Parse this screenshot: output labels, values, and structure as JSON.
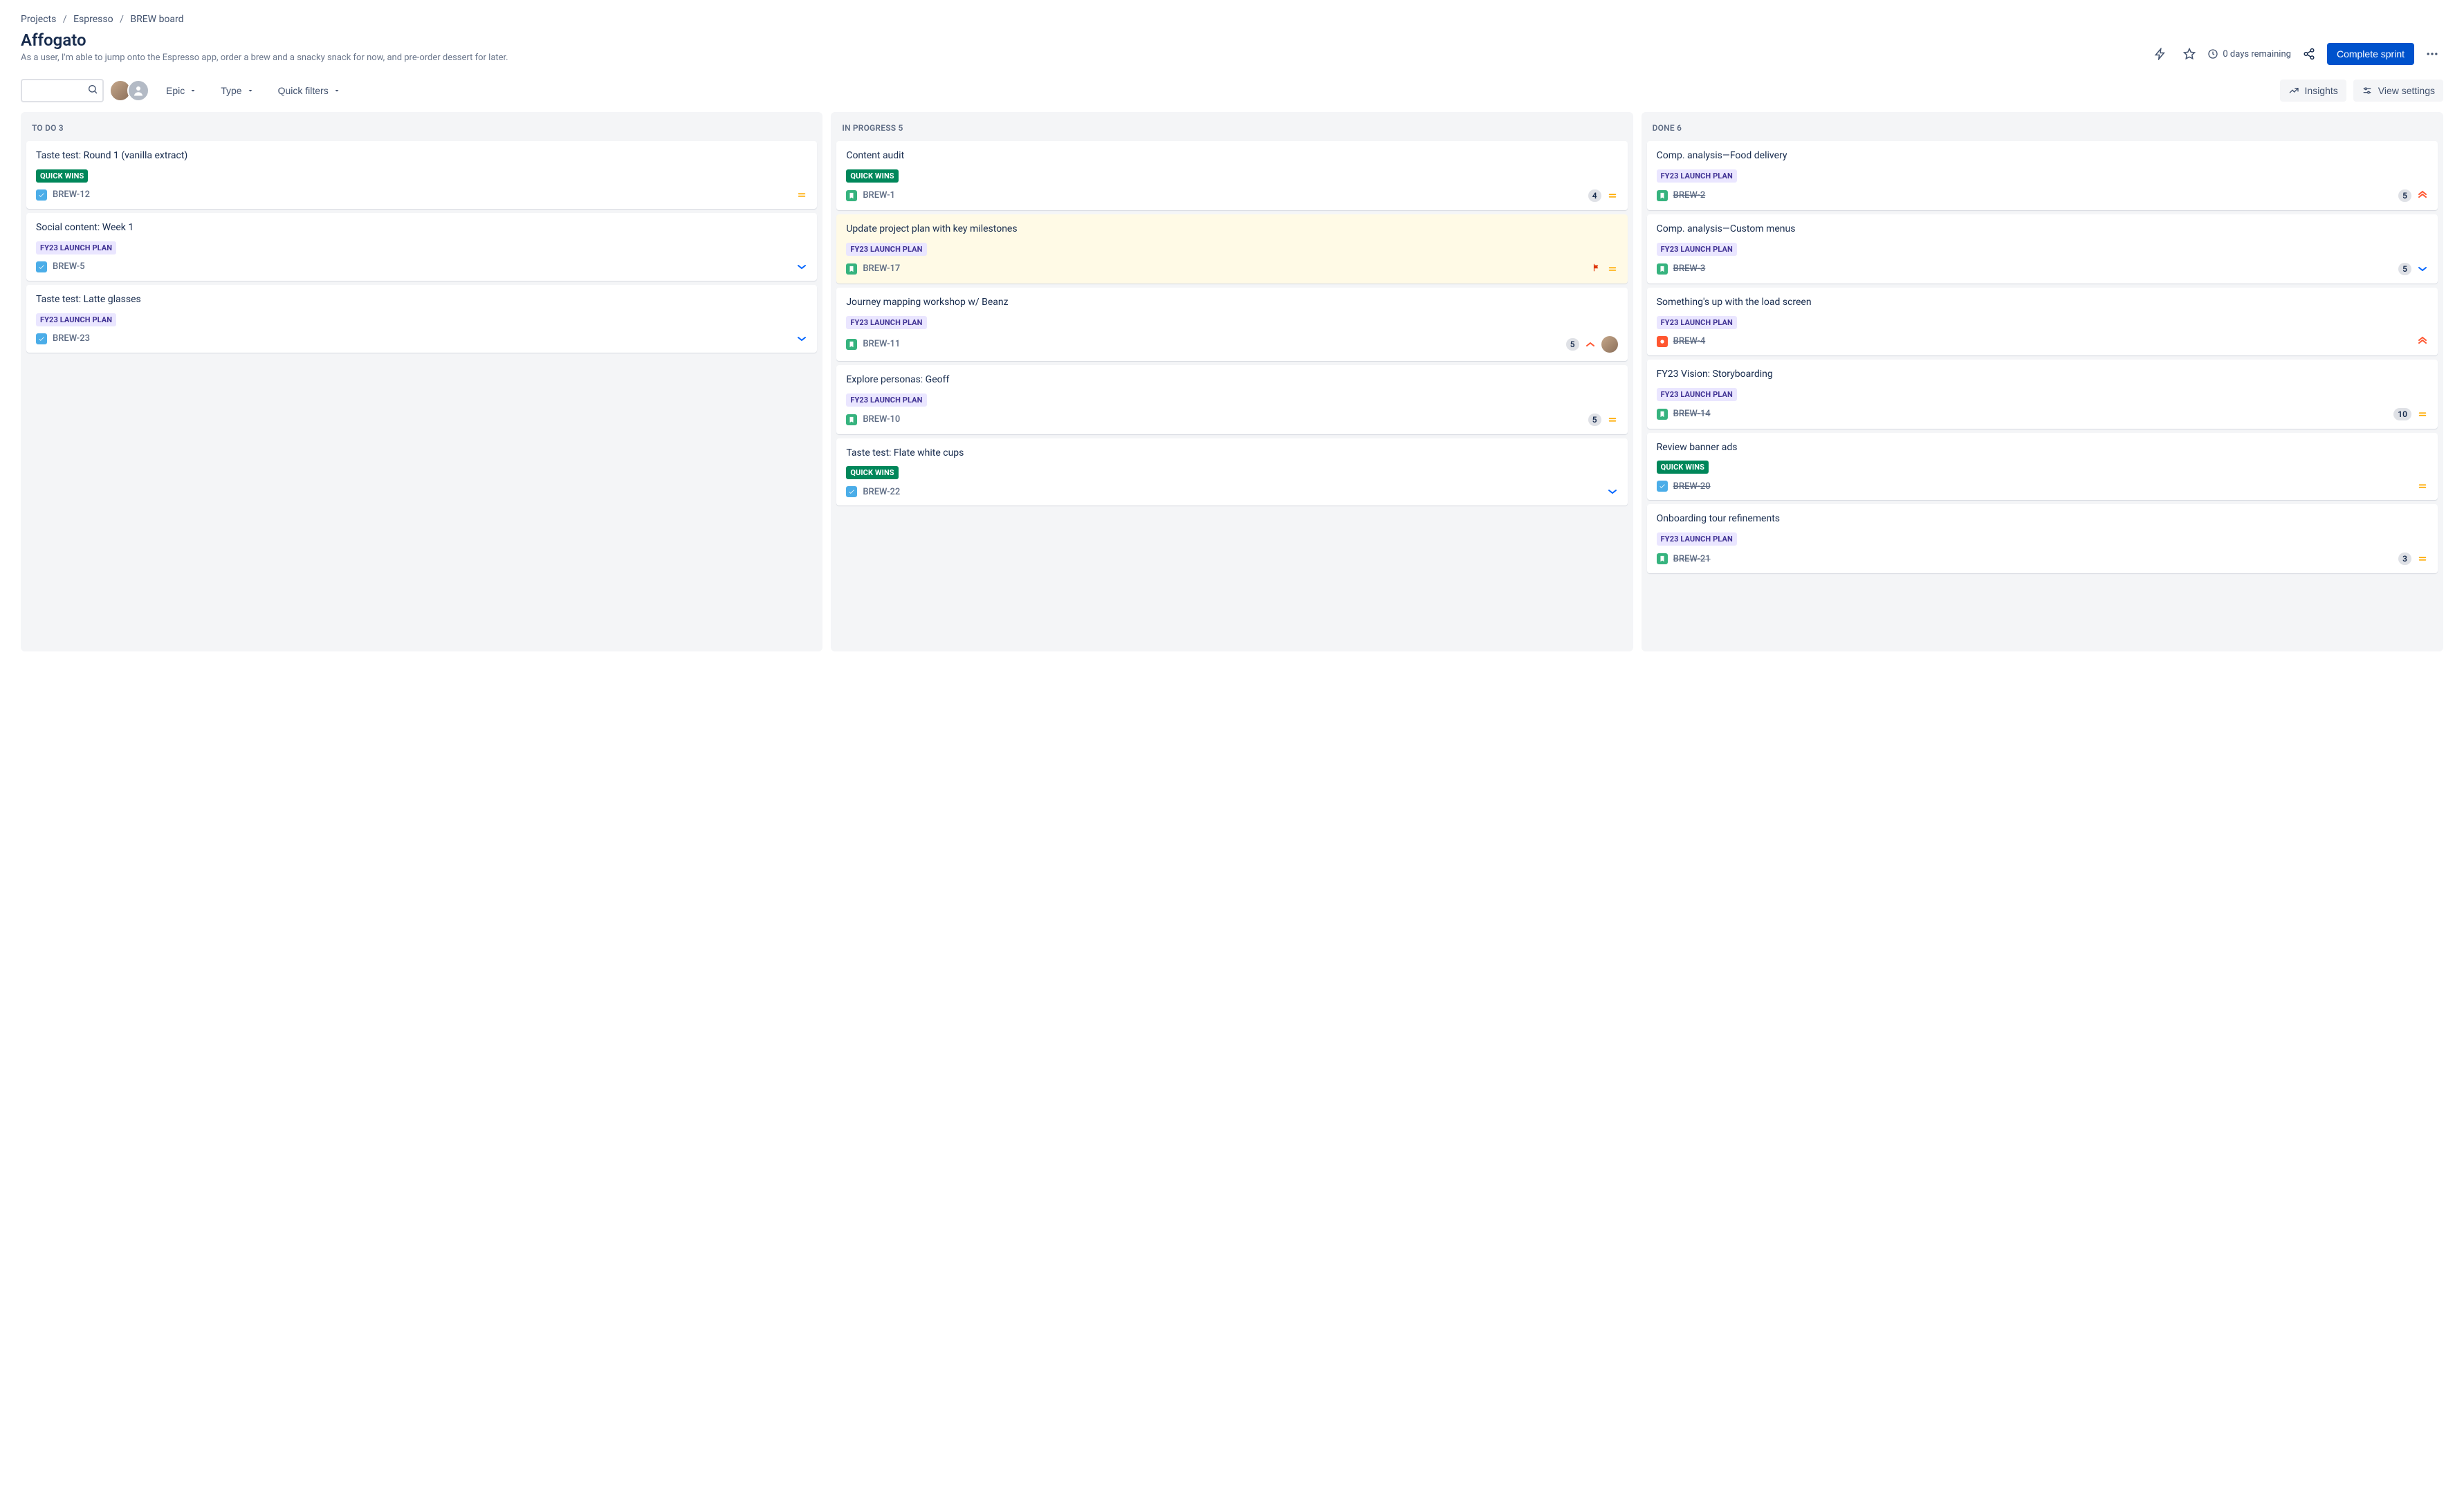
{
  "breadcrumb": {
    "a": "Projects",
    "b": "Espresso",
    "c": "BREW board"
  },
  "sprint": {
    "title": "Affogato",
    "goal": "As a user, I'm able to jump onto the Espresso app, order a brew and a snacky snack for now, and pre-order dessert for later."
  },
  "header": {
    "remaining": "0 days remaining",
    "complete": "Complete sprint"
  },
  "filters": {
    "epic": "Epic",
    "type": "Type",
    "quick": "Quick filters",
    "insights": "Insights",
    "view": "View settings"
  },
  "labels": {
    "quickwins": "QUICK WINS",
    "fy23": "FY23 LAUNCH PLAN"
  },
  "columns": {
    "todo": {
      "title": "TO DO",
      "count": "3"
    },
    "inprogress": {
      "title": "IN PROGRESS",
      "count": "5"
    },
    "done": {
      "title": "DONE",
      "count": "6"
    }
  },
  "cards": {
    "todo": [
      {
        "title": "Taste test: Round 1 (vanilla extract)",
        "label": "quickwins",
        "type": "task",
        "key": "BREW-12",
        "priority": "medium"
      },
      {
        "title": "Social content: Week 1",
        "label": "fy23",
        "type": "task",
        "key": "BREW-5",
        "priority": "low"
      },
      {
        "title": "Taste test: Latte glasses",
        "label": "fy23",
        "type": "task",
        "key": "BREW-23",
        "priority": "low"
      }
    ],
    "inprogress": [
      {
        "title": "Content audit",
        "label": "quickwins",
        "type": "story",
        "key": "BREW-1",
        "points": "4",
        "priority": "medium"
      },
      {
        "title": "Update project plan with key milestones",
        "label": "fy23",
        "type": "story",
        "key": "BREW-17",
        "priority": "medium",
        "flagged": true
      },
      {
        "title": "Journey mapping workshop w/ Beanz",
        "label": "fy23",
        "type": "story",
        "key": "BREW-11",
        "points": "5",
        "priority": "high",
        "assignee": true
      },
      {
        "title": "Explore personas: Geoff",
        "label": "fy23",
        "type": "story",
        "key": "BREW-10",
        "points": "5",
        "priority": "medium"
      },
      {
        "title": "Taste test: Flate white cups",
        "label": "quickwins",
        "type": "task",
        "key": "BREW-22",
        "priority": "low"
      }
    ],
    "done": [
      {
        "title": "Comp. analysis—Food delivery",
        "label": "fy23",
        "type": "story",
        "key": "BREW-2",
        "points": "5",
        "priority": "highest",
        "done": true
      },
      {
        "title": "Comp. analysis—Custom menus",
        "label": "fy23",
        "type": "story",
        "key": "BREW-3",
        "points": "5",
        "priority": "low",
        "done": true
      },
      {
        "title": "Something's up with the load screen",
        "label": "fy23",
        "type": "bug",
        "key": "BREW-4",
        "priority": "highest",
        "done": true
      },
      {
        "title": "FY23 Vision: Storyboarding",
        "label": "fy23",
        "type": "story",
        "key": "BREW-14",
        "points": "10",
        "priority": "medium",
        "done": true
      },
      {
        "title": "Review banner ads",
        "label": "quickwins",
        "type": "task",
        "key": "BREW-20",
        "priority": "medium",
        "done": true
      },
      {
        "title": "Onboarding tour refinements",
        "label": "fy23",
        "type": "story",
        "key": "BREW-21",
        "points": "3",
        "priority": "medium",
        "done": true
      }
    ]
  }
}
